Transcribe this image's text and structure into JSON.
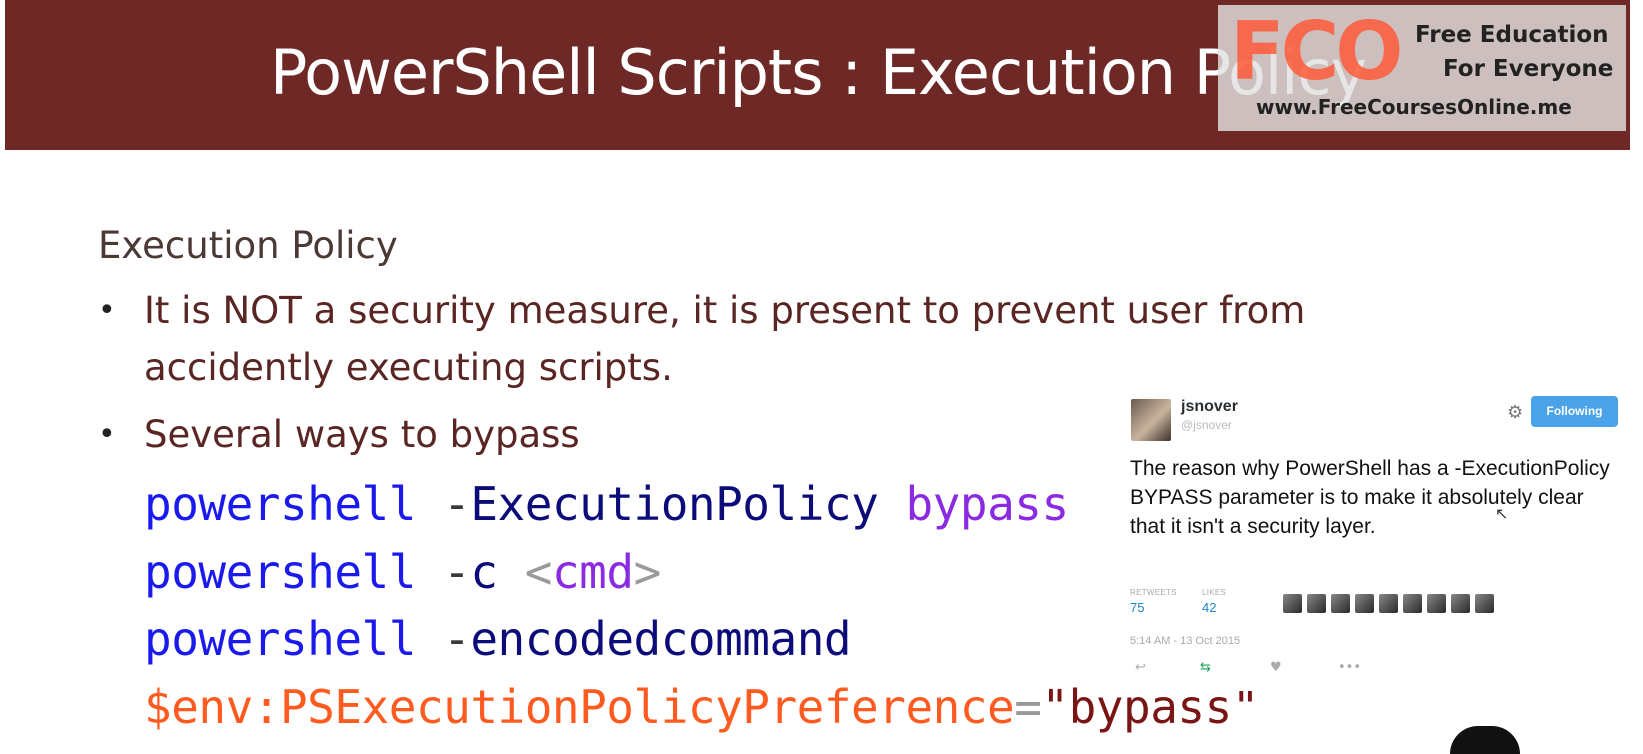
{
  "slide": {
    "title": "PowerShell Scripts : Execution Policy",
    "heading": "Execution Policy",
    "bullets": [
      "It is NOT a security measure, it is present to prevent user from",
      "accidently executing scripts.",
      "Several ways to bypass"
    ],
    "code": {
      "line1": {
        "cmd": "powershell",
        "dash": "-",
        "param": "ExecutionPolicy",
        "arg": "bypass"
      },
      "line2": {
        "cmd": "powershell",
        "dash": "-",
        "param": "c",
        "lt": "<",
        "arg": "cmd",
        "gt": ">"
      },
      "line3": {
        "cmd": "powershell",
        "dash": "-",
        "param": "encodedcommand"
      },
      "line4": {
        "var": "$env:PSExecutionPolicyPreference",
        "eq": "=",
        "str": "\"bypass\""
      }
    }
  },
  "watermark": {
    "logo": "FCO",
    "line1": "Free Education",
    "line2": "For Everyone",
    "url": "www.FreeCoursesOnline.me"
  },
  "tweet": {
    "username": "jsnover",
    "handle": "@jsnover",
    "follow_label": "Following",
    "text": "The reason why PowerShell has a -ExecutionPolicy BYPASS parameter is to make it absolutely clear that it isn't a security layer.",
    "retweets_label": "RETWEETS",
    "retweets": "75",
    "likes_label": "LIKES",
    "likes": "42",
    "timestamp": "5:14 AM - 13 Oct 2015",
    "icons": [
      "reply-icon",
      "retweet-icon",
      "like-icon",
      "more-icon",
      "gear-icon"
    ]
  }
}
